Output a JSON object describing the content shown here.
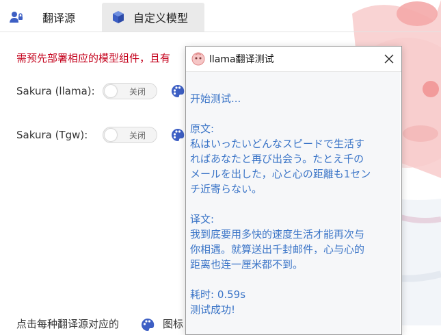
{
  "tabs": [
    {
      "label": "翻译源",
      "icon": "user-key-icon"
    },
    {
      "label": "自定义模型",
      "icon": "cube-icon"
    }
  ],
  "notice": "需预先部署相应的模型组件，且有",
  "models": [
    {
      "label": "Sakura (llama):",
      "toggle_text": "关闭",
      "enabled": false
    },
    {
      "label": "Sakura (Tgw):",
      "toggle_text": "关闭",
      "enabled": false
    }
  ],
  "footer": {
    "text": "点击每种翻译源对应的",
    "text2": "图标"
  },
  "dialog": {
    "title": "llama翻译测试",
    "log": [
      "开始测试...",
      "",
      "原文:",
      "私はいったいどんなスピードで生活す",
      "ればあなたと再び出会う。たとえ千の",
      "メールを出した，心と心の距離も1セン",
      "チ近寄らない。",
      "",
      "译文:",
      "我到底要用多快的速度生活才能再次与",
      "你相遇。就算送出千封邮件，心与心的",
      "距离也连一厘米都不到。",
      "",
      "耗时: 0.59s",
      "测试成功!"
    ]
  },
  "colors": {
    "accent": "#3a74c7",
    "notice": "#c4001b",
    "palette": "#3d5fc4"
  }
}
